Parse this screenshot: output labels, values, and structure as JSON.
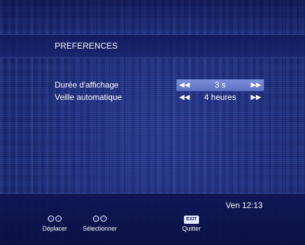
{
  "title": "PREFERENCES",
  "rows": [
    {
      "label": "Durée d'affichage",
      "value": "3 s",
      "selected": true
    },
    {
      "label": "Veille automatique",
      "value": "4 heures",
      "selected": false
    }
  ],
  "arrows": {
    "left": "◀◀",
    "right": "▶▶"
  },
  "status": {
    "clock": "Ven 12:13"
  },
  "footer": {
    "move_label": "Déplacer",
    "select_label": "Sélectionner",
    "exit_key": "EXIT",
    "quit_label": "Quitter"
  },
  "colors": {
    "background": "#1b2770",
    "highlight": "#6f82d0",
    "text": "#ffffff"
  }
}
